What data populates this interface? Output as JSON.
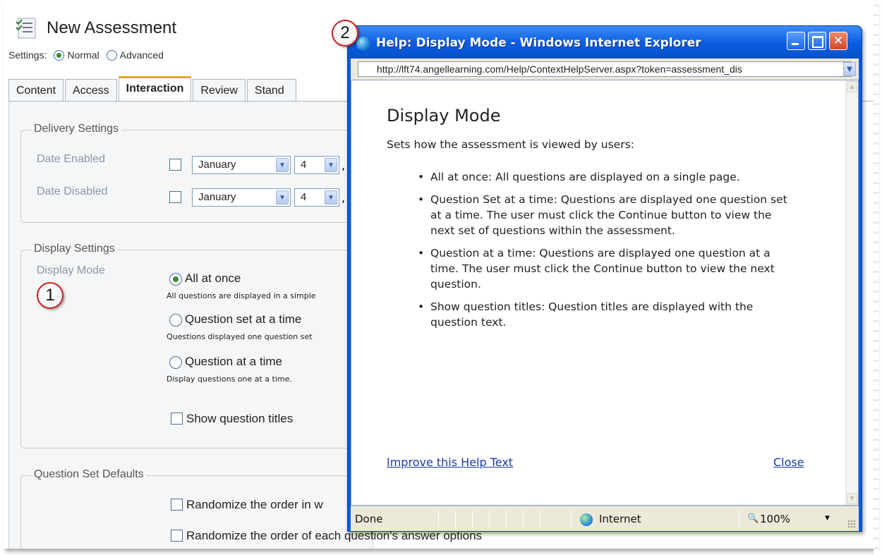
{
  "page": {
    "title": "New Assessment",
    "settings_label": "Settings:",
    "settings_options": [
      "Normal",
      "Advanced"
    ],
    "settings_selected": "Normal"
  },
  "tabs": [
    "Content",
    "Access",
    "Interaction",
    "Review",
    "Stand"
  ],
  "active_tab": "Interaction",
  "delivery": {
    "legend": "Delivery Settings",
    "rows": [
      {
        "label": "Date Enabled",
        "month": "January",
        "day": "4"
      },
      {
        "label": "Date Disabled",
        "month": "January",
        "day": "4"
      }
    ],
    "comma": ","
  },
  "display": {
    "legend": "Display Settings",
    "field_label": "Display Mode",
    "options": [
      {
        "label": "All at once",
        "desc": "All questions are displayed in a simple",
        "selected": true
      },
      {
        "label": "Question set at a time",
        "desc": "Questions displayed one question set",
        "selected": false
      },
      {
        "label": "Question at a time",
        "desc": "Display questions one at a time.",
        "selected": false
      }
    ],
    "show_titles_label": "Show question titles"
  },
  "question_set": {
    "legend": "Question Set Defaults",
    "randomize_1": "Randomize the order in w",
    "randomize_2": "Randomize the order of each question's answer options"
  },
  "callouts": [
    "1",
    "2"
  ],
  "ie": {
    "window_title": "Help: Display Mode - Windows Internet Explorer",
    "url": "http://lft74.angellearning.com/Help/ContextHelpServer.aspx?token=assessment_dis",
    "help_title": "Display Mode",
    "help_intro": "Sets how the assessment is viewed by users:",
    "help_items": [
      "All at once: All questions are displayed on a single page.",
      "Question Set at a time: Questions are displayed one question set at a time. The user must click the Continue button to view the next set of questions within the assessment.",
      "Question at a time: Questions are displayed one question at a time. The user must click the Continue button to view the next question.",
      "Show question titles: Question titles are displayed with the question text."
    ],
    "improve_link": "Improve this Help Text",
    "close_link": "Close",
    "status_text": "Done",
    "zone_text": "Internet",
    "zoom_text": "100%",
    "zoom_arrow": "▼"
  },
  "colors": {
    "tab_accent": "#e9a62a",
    "ie_blue": "#0a5be0",
    "link": "#1a3aa8",
    "callout_ring": "#c72020"
  }
}
